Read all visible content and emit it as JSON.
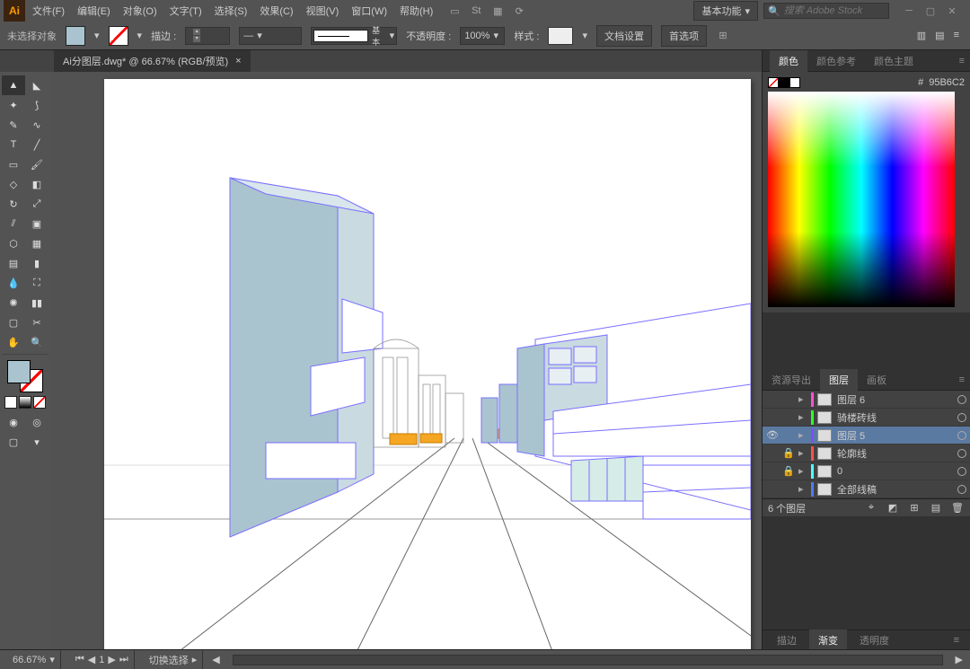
{
  "menubar": {
    "app_abbr": "Ai",
    "items": [
      "文件(F)",
      "编辑(E)",
      "对象(O)",
      "文字(T)",
      "选择(S)",
      "效果(C)",
      "视图(V)",
      "窗口(W)",
      "帮助(H)"
    ],
    "workspace": "基本功能",
    "search_placeholder": "搜索 Adobe Stock"
  },
  "control": {
    "no_selection": "未选择对象",
    "stroke_label": "描边 :",
    "stroke_width": "",
    "stroke_style": "基本",
    "opacity_label": "不透明度 :",
    "opacity_value": "100%",
    "style_label": "样式 :",
    "doc_setup": "文档设置",
    "preferences": "首选项"
  },
  "document": {
    "tab_title": "Ai分图层.dwg* @ 66.67% (RGB/预览)",
    "close": "×"
  },
  "color_panel": {
    "tabs": [
      "颜色",
      "颜色参考",
      "颜色主题"
    ],
    "hex_prefix": "#",
    "hex_value": "95B6C2"
  },
  "layers_panel": {
    "tabs": [
      "资源导出",
      "图层",
      "画板"
    ],
    "layers": [
      {
        "color": "#ff4fd2",
        "name": "图层 6",
        "vis": "",
        "lock": ""
      },
      {
        "color": "#2aff2a",
        "name": "骑楼砖线",
        "vis": "",
        "lock": ""
      },
      {
        "color": "#7a4fff",
        "name": "图层 5",
        "vis": "👁",
        "lock": "",
        "selected": true
      },
      {
        "color": "#ff4f4f",
        "name": "轮廓线",
        "vis": "",
        "lock": "🔒"
      },
      {
        "color": "#4fffff",
        "name": "0",
        "vis": "",
        "lock": "🔒"
      },
      {
        "color": "#4f7aff",
        "name": "全部线稿",
        "vis": "",
        "lock": ""
      }
    ],
    "footer_count": "6 个图层"
  },
  "bottom_panel": {
    "tabs": [
      "描边",
      "渐变",
      "透明度"
    ]
  },
  "status": {
    "zoom": "66.67%",
    "tool_hint": "切换选择"
  }
}
